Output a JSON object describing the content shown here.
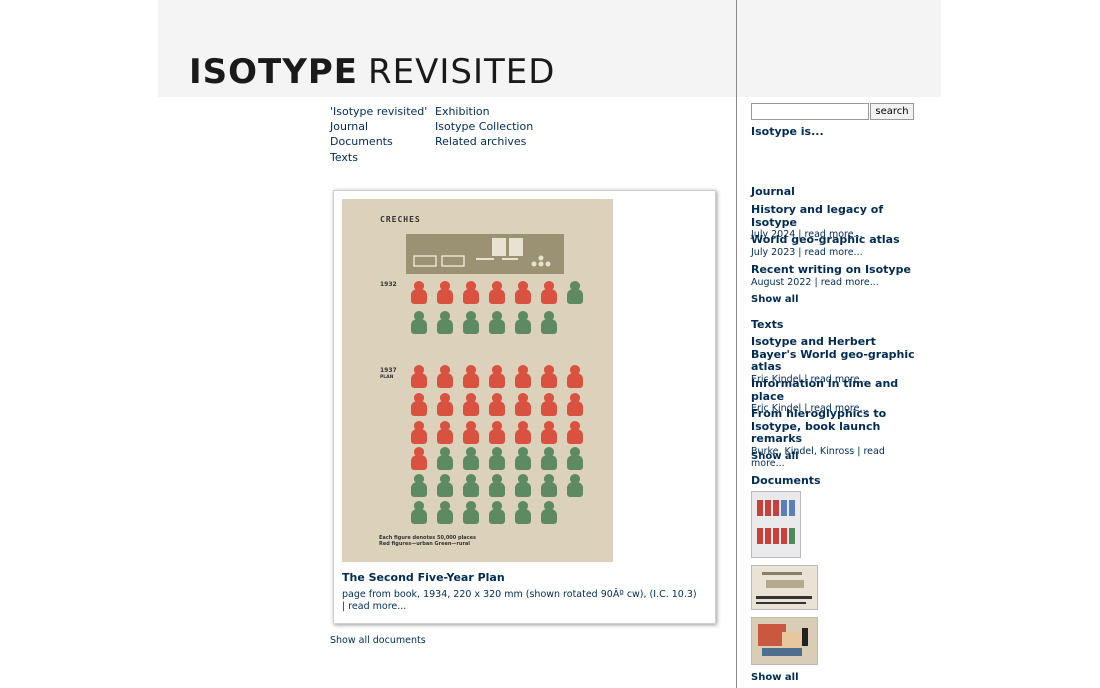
{
  "header": {
    "logo_bold": "ISOTYPE",
    "logo_light": "REVISITED"
  },
  "nav": {
    "col1": [
      "'Isotype revisited'",
      "Journal",
      "Documents",
      "Texts"
    ],
    "col2": [
      "Exhibition",
      "Isotype Collection",
      "Related archives"
    ]
  },
  "feature": {
    "poster_heading": "CRECHES",
    "poster_year1": "1932",
    "poster_year2": "1937",
    "poster_year2_sub": "PLAN",
    "poster_legend_1": "Each figure denotes 50,000 places",
    "poster_legend_2": "Red figures—urban  Green—rural",
    "title": "The Second Five-Year Plan",
    "description": "page from book, 1934, 220 x 320 mm (shown rotated 90Âº cw), (I.C. 10.3) | ",
    "read_more": "read more..."
  },
  "show_all_documents": "Show all documents",
  "search": {
    "value": "",
    "button": "search"
  },
  "isotype_is": "Isotype is...",
  "journal": {
    "heading": "Journal",
    "items": [
      {
        "title": "History and legacy of Isotype",
        "meta": "July 2024 | ",
        "link": "read more..."
      },
      {
        "title": "World geo-graphic atlas",
        "meta": "July 2023 | ",
        "link": "read more..."
      },
      {
        "title": "Recent writing on Isotype",
        "meta": "August 2022 | ",
        "link": "read more..."
      }
    ],
    "show_all": "Show all"
  },
  "texts": {
    "heading": "Texts",
    "items": [
      {
        "title": "Isotype and Herbert Bayer's World geo-graphic atlas",
        "meta": "Eric Kindel | ",
        "link": "read more..."
      },
      {
        "title": "Information in time and place",
        "meta": "Eric Kindel | ",
        "link": "read more..."
      },
      {
        "title": "From hieroglyphics to Isotype, book launch remarks",
        "meta": "Burke, Kindel, Kinross | ",
        "link": "read more..."
      }
    ],
    "show_all": "Show all"
  },
  "documents": {
    "heading": "Documents",
    "show_all": "Show all"
  },
  "colors": {
    "link": "#002b55",
    "red_figure": "#d9513f",
    "green_figure": "#5e8a63",
    "poster_bg": "#dcd2bc"
  }
}
